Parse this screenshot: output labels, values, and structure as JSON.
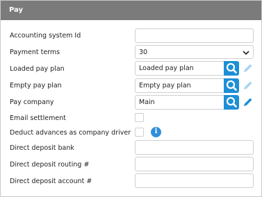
{
  "panel": {
    "title": "Pay"
  },
  "fields": {
    "accounting_system_id": {
      "label": "Accounting system Id",
      "value": ""
    },
    "payment_terms": {
      "label": "Payment terms",
      "value": "30"
    },
    "loaded_pay_plan": {
      "label": "Loaded pay plan",
      "value": "Loaded pay plan",
      "edit_enabled": false
    },
    "empty_pay_plan": {
      "label": "Empty pay plan",
      "value": "Empty pay plan",
      "edit_enabled": false
    },
    "pay_company": {
      "label": "Pay company",
      "value": "Main",
      "edit_enabled": true
    },
    "email_settlement": {
      "label": "Email settlement",
      "checked": false
    },
    "deduct_advances": {
      "label": "Deduct advances as company driver",
      "checked": false
    },
    "direct_deposit_bank": {
      "label": "Direct deposit bank",
      "value": ""
    },
    "direct_deposit_routing": {
      "label": "Direct deposit routing #",
      "value": ""
    },
    "direct_deposit_account": {
      "label": "Direct deposit account #",
      "value": ""
    }
  },
  "icons": {
    "search": "search-icon",
    "edit": "pencil-icon",
    "info": "info-icon",
    "dropdown": "chevron-down-icon"
  },
  "colors": {
    "header_bg": "#7b7b7b",
    "accent_blue": "#1e8fd6",
    "pencil_active": "#1e8fd6",
    "pencil_disabled": "#a9d3f0"
  }
}
